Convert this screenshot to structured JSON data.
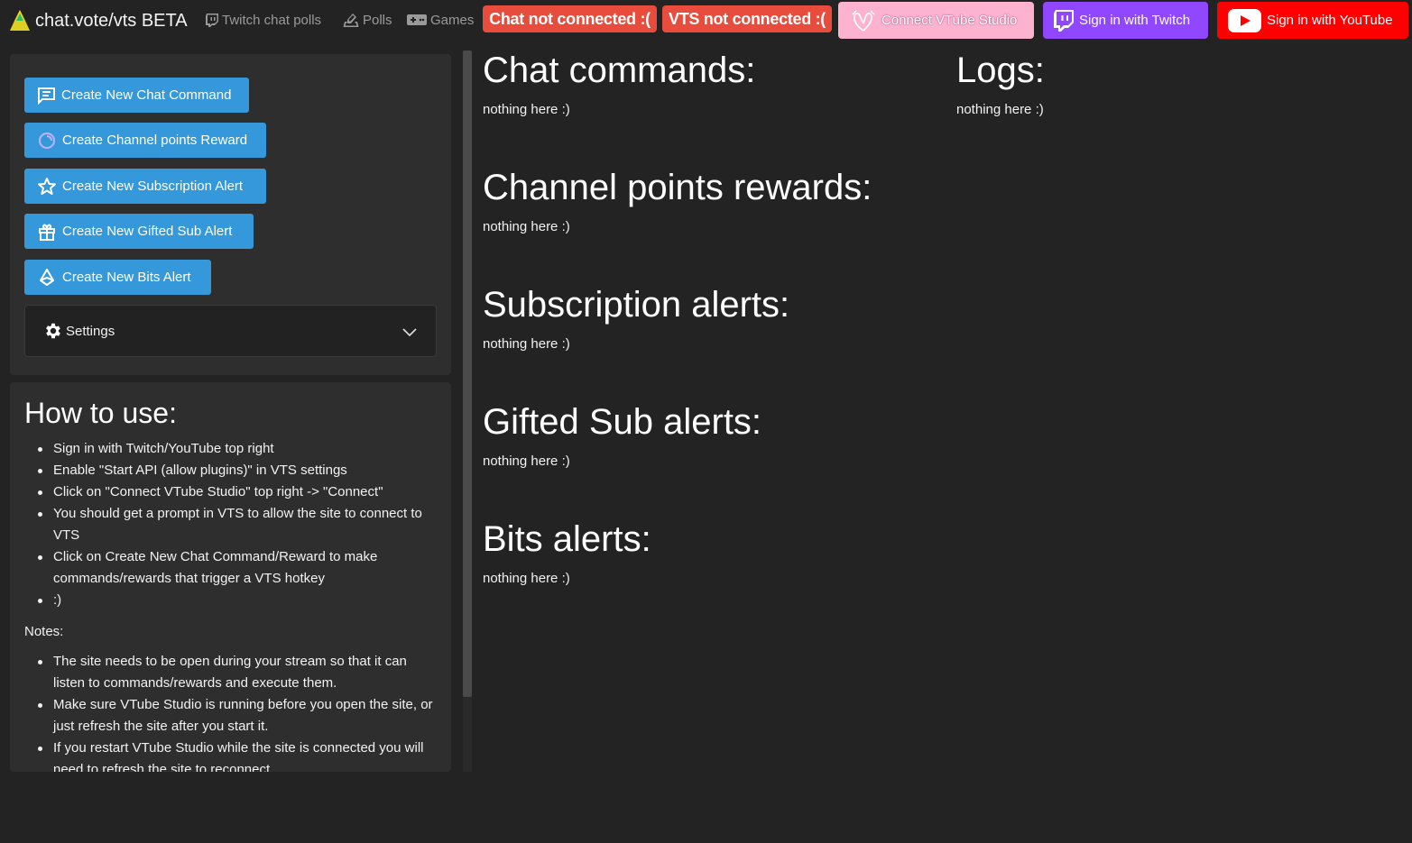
{
  "navbar": {
    "brand": "chat.vote/vts BETA",
    "links": [
      {
        "label": "Twitch chat polls",
        "icon": "twitch-icon"
      },
      {
        "label": "Polls",
        "icon": "ballot-icon"
      },
      {
        "label": "Games",
        "icon": "gamepad-icon"
      }
    ],
    "status": {
      "chat": "Chat not connected :(",
      "vts": "VTS not connected :("
    },
    "buttons": {
      "vts": "Connect VTube Studio",
      "twitch": "Sign in with Twitch",
      "youtube": "Sign in with YouTube"
    }
  },
  "sidebar": {
    "actions": [
      {
        "label": "Create New Chat Command",
        "icon": "chat-icon"
      },
      {
        "label": "Create Channel points Reward",
        "icon": "channel-points-icon"
      },
      {
        "label": "Create New Subscription Alert",
        "icon": "star-icon"
      },
      {
        "label": "Create New Gifted Sub Alert",
        "icon": "gift-icon"
      },
      {
        "label": "Create New Bits Alert",
        "icon": "bits-icon"
      }
    ],
    "settings_label": "Settings"
  },
  "help": {
    "title": "How to use:",
    "steps": [
      "Sign in with Twitch/YouTube top right",
      "Enable \"Start API (allow plugins)\" in VTS settings",
      "Click on \"Connect VTube Studio\" top right -> \"Connect\"",
      "You should get a prompt in VTS to allow the site to connect to VTS",
      "Click on Create New Chat Command/Reward to make commands/rewards that trigger a VTS hotkey",
      ":)"
    ],
    "notes_label": "Notes:",
    "notes": [
      "The site needs to be open during your stream so that it can listen to commands/rewards and execute them.",
      "Make sure VTube Studio is running before you open the site, or just refresh the site after you start it.",
      "If you restart VTube Studio while the site is connected you will need to refresh the site to reconnect"
    ]
  },
  "main": {
    "sections": [
      {
        "title": "Chat commands:",
        "empty": "nothing here :)"
      },
      {
        "title": "Channel points rewards:",
        "empty": "nothing here :)"
      },
      {
        "title": "Subscription alerts:",
        "empty": "nothing here :)"
      },
      {
        "title": "Gifted Sub alerts:",
        "empty": "nothing here :)"
      },
      {
        "title": "Bits alerts:",
        "empty": "nothing here :)"
      }
    ],
    "logs": {
      "title": "Logs:",
      "empty": "nothing here :)"
    }
  },
  "colors": {
    "background": "#232323",
    "panel": "#2e2e2e",
    "action_button": "#3498db",
    "status_error": "#e74c3c",
    "vts_pink": "#fdb3cf",
    "twitch_purple": "#9147ff",
    "youtube_red": "#ff0000"
  }
}
